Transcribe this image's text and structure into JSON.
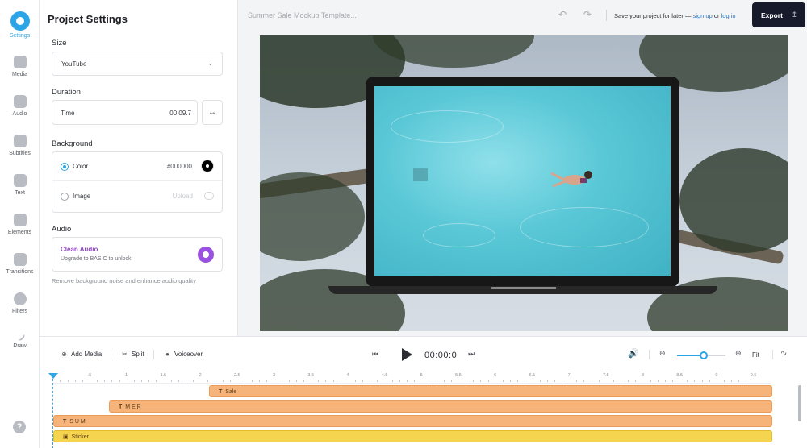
{
  "sidebar": {
    "items": [
      {
        "label": "Settings",
        "icon": "settings-icon",
        "active": true
      },
      {
        "label": "Media",
        "icon": "plus-icon"
      },
      {
        "label": "Audio",
        "icon": "music-note-icon"
      },
      {
        "label": "Subtitles",
        "icon": "subtitles-icon"
      },
      {
        "label": "Text",
        "icon": "text-icon"
      },
      {
        "label": "Elements",
        "icon": "elements-icon"
      },
      {
        "label": "Transitions",
        "icon": "transitions-icon"
      },
      {
        "label": "Filters",
        "icon": "filters-icon"
      },
      {
        "label": "Draw",
        "icon": "pencil-icon"
      }
    ],
    "help": "?"
  },
  "panel": {
    "title": "Project Settings",
    "size": {
      "label": "Size",
      "value": "YouTube"
    },
    "duration": {
      "label": "Duration",
      "field_label": "Time",
      "value": "00:09.7"
    },
    "background": {
      "label": "Background",
      "color_label": "Color",
      "color_value": "#000000",
      "image_label": "Image",
      "upload_label": "Upload"
    },
    "audio": {
      "label": "Audio",
      "clean_title": "Clean Audio",
      "clean_sub": "Upgrade to BASIC to unlock",
      "note": "Remove background noise and enhance audio quality"
    }
  },
  "topbar": {
    "project_title": "Summer Sale Mockup Template...",
    "save_prefix": "Save your project for later —",
    "sign_up": "sign up",
    "or": "or",
    "log_in": "log in",
    "export_label": "Export"
  },
  "timeline": {
    "add_media": "Add Media",
    "split": "Split",
    "voiceover": "Voiceover",
    "time": "00:00:0",
    "fit": "Fit",
    "zoom_level": 0.55,
    "ruler_ticks": [
      ".5",
      "1",
      "1.5",
      "2",
      "2.5",
      "3",
      "3.5",
      "4",
      "4.5",
      "5",
      "5.5",
      "6",
      "6.5",
      "7",
      "7.5",
      "8",
      "8.5",
      "9",
      "9.5"
    ],
    "tracks": [
      {
        "label": "Sale",
        "type": "text"
      },
      {
        "label": "M E R",
        "type": "text"
      },
      {
        "label": "S U M",
        "type": "text"
      },
      {
        "label": "Sticker",
        "type": "sticker"
      }
    ]
  },
  "colors": {
    "accent": "#2ca4e6",
    "export_bg": "#171a2b",
    "text_track": "#f6b47a",
    "sticker_track": "#f5d54f",
    "clean_audio": "#9b51e0"
  }
}
